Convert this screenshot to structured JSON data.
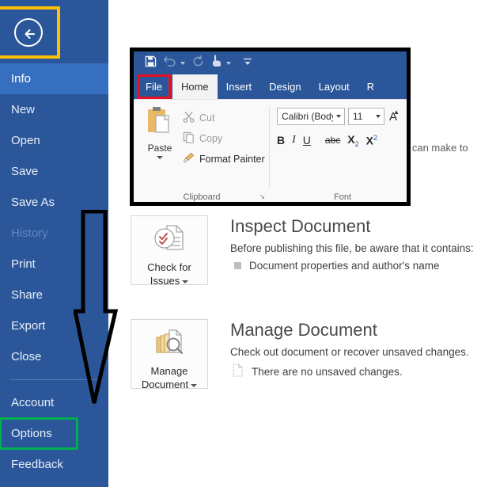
{
  "sidebar": {
    "back_button": {
      "name": "back-arrow",
      "highlight_color": "#ffc000"
    },
    "items": [
      {
        "label": "Info",
        "state": "selected"
      },
      {
        "label": "New",
        "state": "normal"
      },
      {
        "label": "Open",
        "state": "normal"
      },
      {
        "label": "Save",
        "state": "normal"
      },
      {
        "label": "Save As",
        "state": "normal"
      },
      {
        "label": "History",
        "state": "disabled"
      },
      {
        "label": "Print",
        "state": "normal"
      },
      {
        "label": "Share",
        "state": "normal"
      },
      {
        "label": "Export",
        "state": "normal"
      },
      {
        "label": "Close",
        "state": "normal"
      }
    ],
    "items_bottom": [
      {
        "label": "Account",
        "state": "normal"
      },
      {
        "label": "Options",
        "state": "highlighted"
      },
      {
        "label": "Feedback",
        "state": "normal"
      }
    ],
    "background_color": "#2b579a",
    "selected_color": "#366ec0",
    "options_highlight_color": "#00b050"
  },
  "annotations": {
    "arrow": "down-arrow pointing to Options",
    "file_tab_box_color": "#e81123",
    "back_button_box_color": "#ffc000",
    "options_box_color": "#00b050"
  },
  "ribbon": {
    "quick_access": [
      {
        "name": "save-icon",
        "label": "Save"
      },
      {
        "name": "undo-icon",
        "label": "Undo"
      },
      {
        "name": "redo-icon",
        "label": "Redo"
      },
      {
        "name": "touch-mode-icon",
        "label": "Touch/Mouse Mode"
      },
      {
        "name": "customize-qat-icon",
        "label": "Customize Quick Access Toolbar"
      }
    ],
    "tabs": [
      {
        "label": "File",
        "state": "highlighted"
      },
      {
        "label": "Home",
        "state": "active"
      },
      {
        "label": "Insert",
        "state": "normal"
      },
      {
        "label": "Design",
        "state": "normal"
      },
      {
        "label": "Layout",
        "state": "normal"
      },
      {
        "label": "R",
        "state": "clipped"
      }
    ],
    "clipboard": {
      "group_label": "Clipboard",
      "paste_label": "Paste",
      "cut_label": "Cut",
      "copy_label": "Copy",
      "format_painter_label": "Format Painter",
      "dialog_launcher": "↘"
    },
    "font": {
      "group_label": "Font",
      "font_name": "Calibri (Body)",
      "font_size": "11",
      "grow_font": "A",
      "bold": "B",
      "italic": "I",
      "underline": "U",
      "strikethrough": "abc",
      "subscript_base": "X",
      "subscript_sub": "2",
      "superscript_base": "X",
      "superscript_sup": "2"
    }
  },
  "main": {
    "ghost_text": "e can make to",
    "sections": [
      {
        "button_label_line1": "Check for",
        "button_label_line2": "Issues",
        "button_icon": "inspect-document-icon",
        "title": "Inspect Document",
        "description": "Before publishing this file, be aware that it contains:",
        "bullets": [
          {
            "icon": "square-bullet",
            "text": "Document properties and author's name"
          }
        ]
      },
      {
        "button_label_line1": "Manage",
        "button_label_line2": "Document",
        "button_icon": "manage-document-icon",
        "title": "Manage Document",
        "description": "Check out document or recover unsaved changes.",
        "bullets": [
          {
            "icon": "unsaved-doc-icon",
            "text": "There are no unsaved changes."
          }
        ]
      }
    ]
  }
}
